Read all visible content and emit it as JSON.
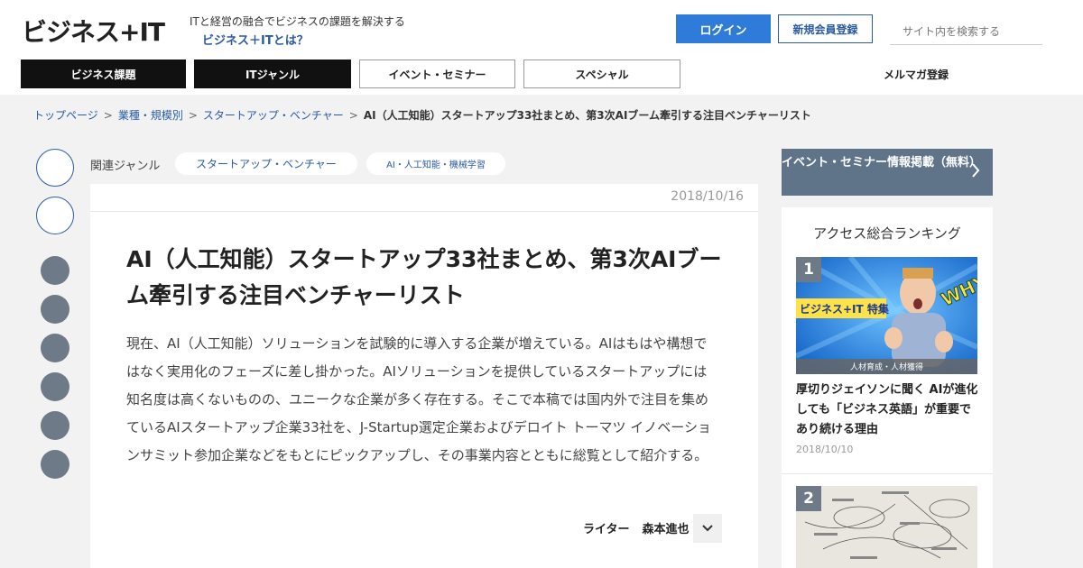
{
  "header": {
    "logo": "ビジネス+IT",
    "tagline": "ITと経営の融合でビジネスの課題を解決する",
    "about_link": "ビジネス＋ITとは？",
    "login": "ログイン",
    "register": "新規会員登録",
    "search_placeholder": "サイト内を検索する"
  },
  "nav": {
    "tabs": [
      "ビジネス課題",
      "ITジャンル",
      "イベント・セミナー",
      "スペシャル"
    ],
    "newsletter": "メルマガ登録"
  },
  "breadcrumb": [
    "トップページ",
    "業種・規模別",
    "スタートアップ・ベンチャー",
    "AI（人工知能）スタートアップ33社まとめ、第3次AIブーム牽引する注目ベンチャーリスト"
  ],
  "genre": {
    "label": "関連ジャンル",
    "chips": [
      "スタートアップ・ベンチャー",
      "AI・人工知能・機械学習"
    ]
  },
  "article": {
    "date": "2018/10/16",
    "title": "AI（人工知能）スタートアップ33社まとめ、第3次AIブーム牽引する注目ベンチャーリスト",
    "lead": "現在、AI（人工知能）ソリューションを試験的に導入する企業が増えている。AIはもはや構想ではなく実用化のフェーズに差し掛かった。AIソリューションを提供しているスタートアップには知名度は高くないものの、ユニークな企業が多く存在する。そこで本稿では国内外で注目を集めているAIスタートアップ企業33社を、J-Startup選定企業およびデロイト トーマツ イノベーションサミット参加企業などをもとにピックアップし、その事業内容とともに総覧として紹介する。",
    "writer_label": "ライター",
    "writer_name": "森本進也"
  },
  "sidebar": {
    "event_banner": "イベント・セミナー情報掲載（無料）",
    "ranking_title": "アクセス総合ランキング",
    "items": [
      {
        "rank": "1",
        "image_caption": "人材育成・人材獲得",
        "image_badge": "ビジネス+IT 特集",
        "image_text": "WHY?",
        "title": "厚切りジェイソンに聞く AIが進化しても「ビジネス英語」が重要であり続ける理由",
        "date": "2018/10/10"
      },
      {
        "rank": "2"
      }
    ]
  },
  "colors": {
    "brand_blue": "#2f7bd9",
    "link_blue": "#2a5aa3",
    "nav_dark": "#111111",
    "banner_slate": "#5f7489"
  }
}
